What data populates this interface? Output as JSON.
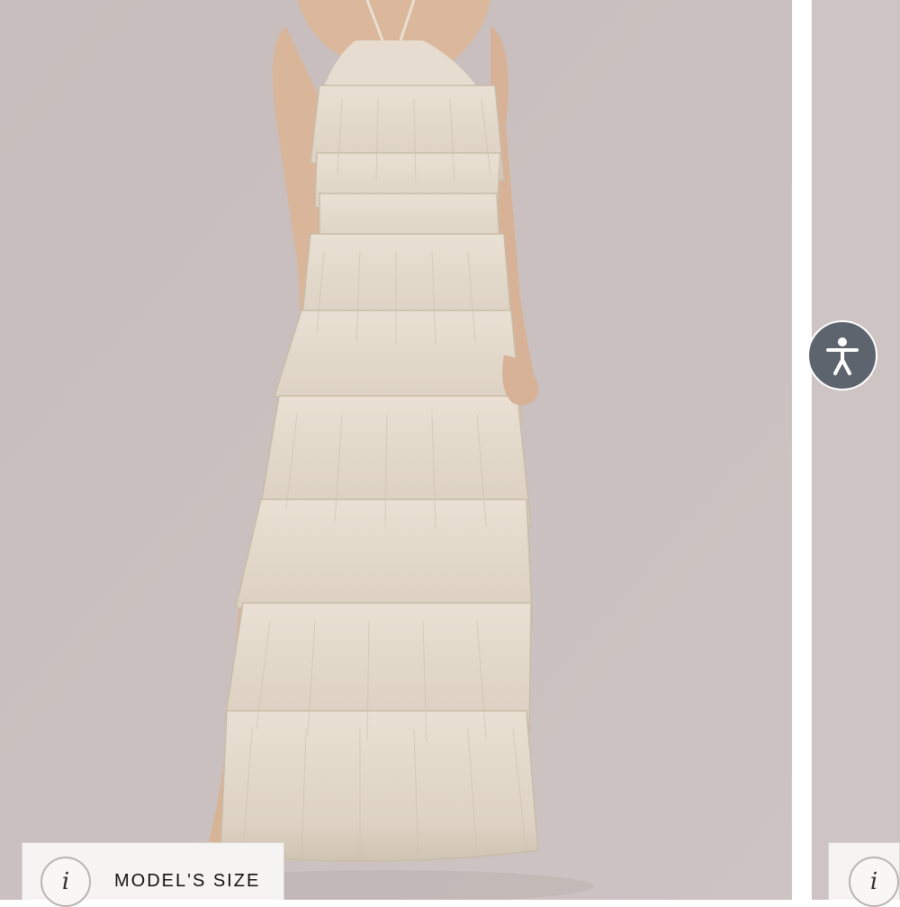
{
  "slides": [
    {
      "type": "product-photo",
      "subject": "tiered ruffle halter maxi dress"
    },
    {
      "type": "product-photo",
      "subject": "next slide"
    }
  ],
  "size_chip": {
    "icon": "info-icon",
    "glyph": "i",
    "label": "MODEL'S SIZE"
  },
  "accessibility": {
    "icon": "accessibility-icon"
  },
  "colors": {
    "backdrop": "#c9bfbe",
    "dress": "#e5dbcd",
    "chip": "#f6f4f3",
    "a11y": "#5d646d"
  }
}
